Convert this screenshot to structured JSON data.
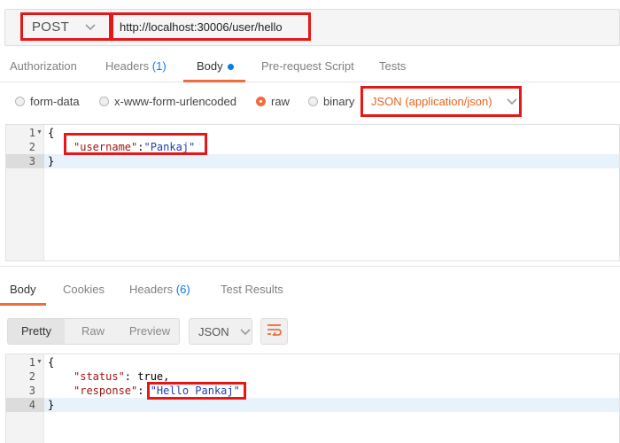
{
  "request": {
    "method": "POST",
    "url": "http://localhost:30006/user/hello"
  },
  "request_tabs": {
    "authorization": "Authorization",
    "headers": "Headers",
    "headers_count": "(1)",
    "body": "Body",
    "prerequest": "Pre-request Script",
    "tests": "Tests"
  },
  "body_types": {
    "form_data": "form-data",
    "urlencoded": "x-www-form-urlencoded",
    "raw": "raw",
    "binary": "binary",
    "selected": "raw",
    "content_type": "JSON (application/json)"
  },
  "request_body": {
    "line_numbers": [
      "1",
      "2",
      "3"
    ],
    "line1": "{",
    "key": "\"username\"",
    "colon": ":",
    "value": "\"Pankaj\"",
    "line3": "}"
  },
  "response_tabs": {
    "body": "Body",
    "cookies": "Cookies",
    "headers": "Headers",
    "headers_count": "(6)",
    "test_results": "Test Results"
  },
  "view_buttons": {
    "pretty": "Pretty",
    "raw": "Raw",
    "preview": "Preview",
    "format": "JSON"
  },
  "response_body": {
    "line_numbers": [
      "1",
      "2",
      "3",
      "4"
    ],
    "line1": "{",
    "status_key": "\"status\"",
    "status_sep": ": ",
    "status_value": "true,",
    "response_key": "\"response\"",
    "response_sep": ": ",
    "response_value": "\"Hello Pankaj\"",
    "line4": "}"
  },
  "colors": {
    "accent": "#f26b3a",
    "link": "#097bed",
    "highlight_box": "#e51717"
  },
  "icons": [
    "chevron-down-icon",
    "wrap-lines-icon",
    "fold-arrow-icon"
  ]
}
